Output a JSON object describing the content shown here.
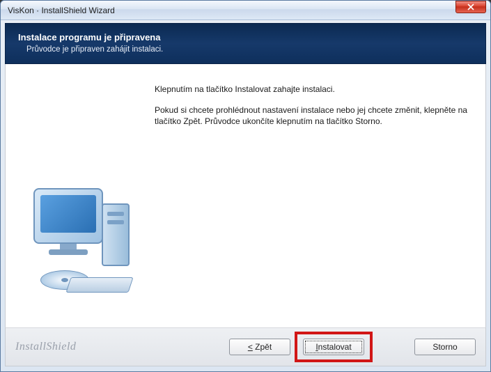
{
  "titlebar": {
    "text": "VisKon · InstallShield Wizard"
  },
  "header": {
    "title": "Instalace programu je připravena",
    "subtitle": "Průvodce je připraven zahájit instalaci."
  },
  "body": {
    "line1": "Klepnutím na tlačítko Instalovat zahajte instalaci.",
    "line2": "Pokud si chcete prohlédnout nastavení instalace nebo jej chcete změnit, klepněte na tlačítko Zpět. Průvodce ukončíte klepnutím na tlačítko Storno."
  },
  "footer": {
    "brand": "InstallShield",
    "back_label": "Zpět",
    "install_label": "Instalovat",
    "cancel_label": "Storno"
  }
}
